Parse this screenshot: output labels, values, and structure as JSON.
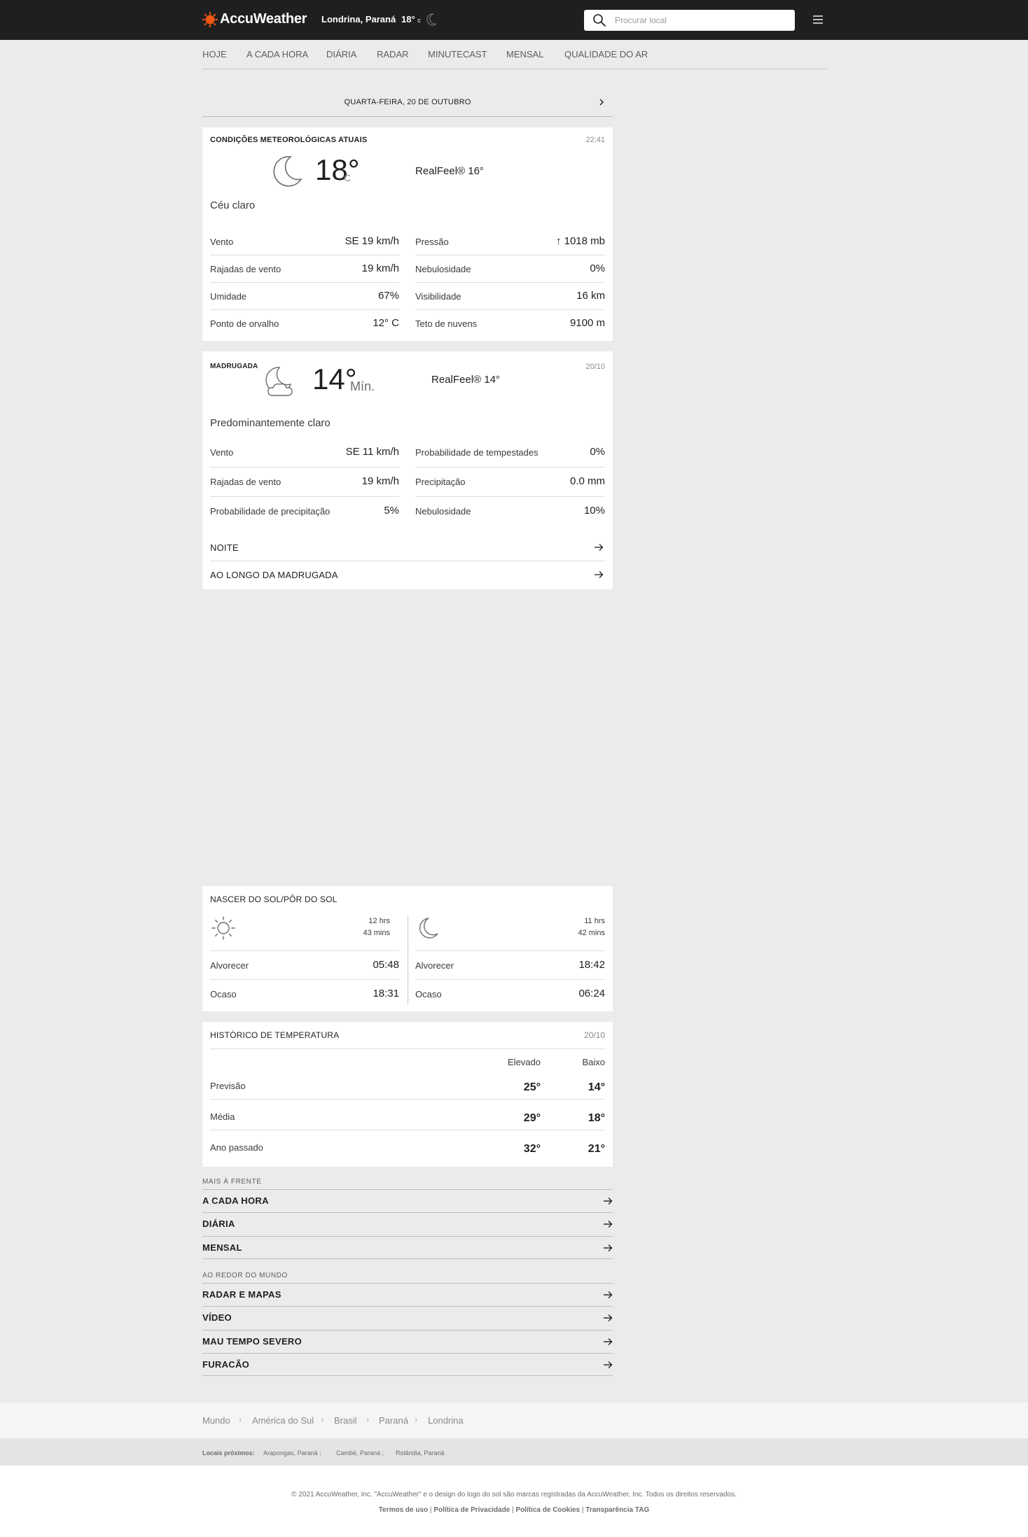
{
  "header": {
    "logo_text": "AccuWeather",
    "location": "Londrina, Paraná",
    "temp": "18°",
    "temp_unit": "c",
    "search_placeholder": "Procurar local"
  },
  "nav": [
    "HOJE",
    "A CADA HORA",
    "DIÁRIA",
    "RADAR",
    "MINUTECAST",
    "MENSAL",
    "QUALIDADE DO AR"
  ],
  "date_bar": "QUARTA-FEIRA, 20 DE OUTUBRO",
  "current": {
    "title": "CONDIÇÕES METEOROLÓGICAS ATUAIS",
    "time": "22:41",
    "temp": "18°",
    "unit": "C",
    "realfeel": "RealFeel® 16°",
    "phrase": "Céu claro",
    "left": [
      {
        "label": "Vento",
        "value": "SE 19 km/h"
      },
      {
        "label": "Rajadas de vento",
        "value": "19 km/h"
      },
      {
        "label": "Umidade",
        "value": "67%"
      },
      {
        "label": "Ponto de orvalho",
        "value": "12° C"
      }
    ],
    "right": [
      {
        "label": "Pressão",
        "value": "↑ 1018 mb"
      },
      {
        "label": "Nebulosidade",
        "value": "0%"
      },
      {
        "label": "Visibilidade",
        "value": "16 km"
      },
      {
        "label": "Teto de nuvens",
        "value": "9100 m"
      }
    ]
  },
  "overnight": {
    "title": "MADRUGADA",
    "date": "20/10",
    "temp": "14°",
    "temp_label": "Mín.",
    "realfeel": "RealFeel® 14°",
    "phrase": "Predominantemente claro",
    "left": [
      {
        "label": "Vento",
        "value": "SE 11 km/h"
      },
      {
        "label": "Rajadas de vento",
        "value": "19 km/h"
      },
      {
        "label": "Probabilidade de precipitação",
        "value": "5%"
      }
    ],
    "right": [
      {
        "label": "Probabilidade de tempestades",
        "value": "0%"
      },
      {
        "label": "Precipitação",
        "value": "0.0 mm"
      },
      {
        "label": "Nebulosidade",
        "value": "10%"
      }
    ],
    "links": [
      "NOITE",
      "AO LONGO DA MADRUGADA"
    ]
  },
  "sun_moon": {
    "title": "NASCER DO SOL/PÔR DO SOL",
    "sun": {
      "duration_hrs": "12 hrs",
      "duration_mins": "43 mins",
      "rise_label": "Alvorecer",
      "rise": "05:48",
      "set_label": "Ocaso",
      "set": "18:31"
    },
    "moon": {
      "duration_hrs": "11 hrs",
      "duration_mins": "42 mins",
      "rise_label": "Alvorecer",
      "rise": "18:42",
      "set_label": "Ocaso",
      "set": "06:24"
    }
  },
  "history": {
    "title": "HISTÓRICO DE TEMPERATURA",
    "date": "20/10",
    "col_high": "Elevado",
    "col_low": "Baixo",
    "rows": [
      {
        "label": "Previsão",
        "high": "25°",
        "low": "14°"
      },
      {
        "label": "Média",
        "high": "29°",
        "low": "18°"
      },
      {
        "label": "Ano passado",
        "high": "32°",
        "low": "21°"
      }
    ]
  },
  "further_ahead": {
    "caption": "MAIS À FRENTE",
    "links": [
      "A CADA HORA",
      "DIÁRIA",
      "MENSAL"
    ]
  },
  "around_world": {
    "caption": "AO REDOR DO MUNDO",
    "links": [
      "RADAR E MAPAS",
      "VÍDEO",
      "MAU TEMPO SEVERO",
      "FURACÃO"
    ]
  },
  "breadcrumb": [
    "Mundo",
    "América do Sul",
    "Brasil",
    "Paraná",
    "Londrina"
  ],
  "nearby": {
    "label": "Locais próximos:",
    "items": [
      "Arapongas, Paraná ;",
      "Cambé, Paraná ;",
      "Rolândia, Paraná"
    ]
  },
  "footer": {
    "copyright": "© 2021 AccuWeather, Inc. \"AccuWeather\" e o design do logo do sol são marcas registradas da AccuWeather, Inc. Todos os direitos reservados.",
    "links": [
      "Termos de uso",
      "Política de Privacidade",
      "Política de Cookies",
      "Transparência TAG"
    ]
  },
  "colors": {
    "brand_orange": "#f05514",
    "header_bg": "#1f1f1f",
    "page_bg": "#ebebeb"
  }
}
